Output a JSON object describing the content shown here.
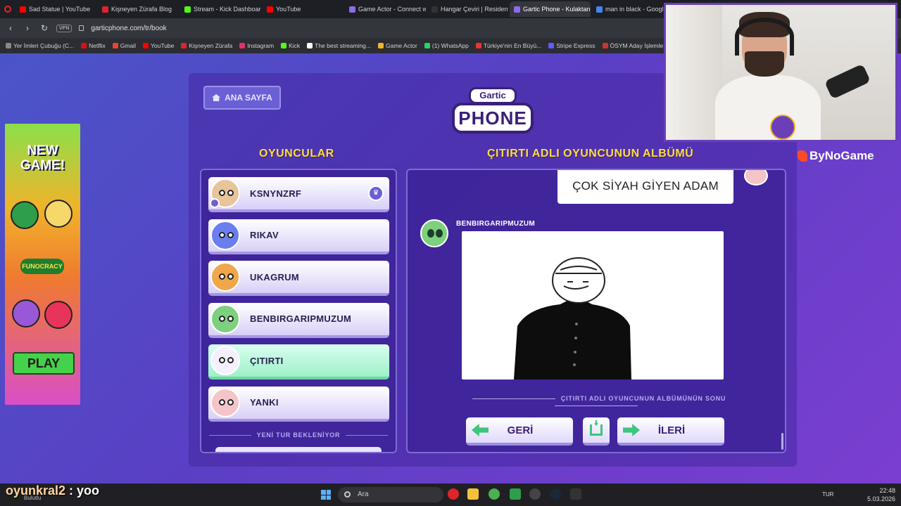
{
  "browser": {
    "tabs": [
      {
        "label": "Sad Statue | YouTube",
        "color": "#ff0000"
      },
      {
        "label": "Kişneyen Zürafa Blog",
        "color": "#e0242b"
      },
      {
        "label": "Stream - Kick Dashboard",
        "color": "#53fc18"
      },
      {
        "label": "YouTube",
        "color": "#ff0000"
      },
      {
        "label": "Game Actor - Connect wit",
        "color": "#8d6be8"
      },
      {
        "label": "Hangar Çeviri | Resident E",
        "color": "#333333"
      },
      {
        "label": "Gartic Phone - Kulaktan K",
        "color": "#8d6be8"
      },
      {
        "label": "man in black - Google'da",
        "color": "#4285f4"
      }
    ],
    "active_tab": 6,
    "vpn": "VPN",
    "url": "garticphone.com/tr/book",
    "bookmarks": [
      "Yer İmleri Çubuğu (C...",
      "Netflix",
      "Gmail",
      "YouTube",
      "Kişneyen Zürafa",
      "Instagram",
      "Kick",
      "The best streaming...",
      "Game Actor",
      "(1) WhatsApp",
      "Türkiye'nin En Büyü...",
      "Stripe Express",
      "ÖSYM Aday İşlemle..."
    ]
  },
  "ad": {
    "title": "NEW GAME!",
    "brand": "FUNOCRACY",
    "play": "PLAY"
  },
  "game": {
    "home_button": "ANA SAYFA",
    "logo_top": "Gartic",
    "logo_bottom": "PHONE",
    "players_title": "OYUNCULAR",
    "album_title": "ÇITIRTI ADLI OYUNCUNUN ALBÜMÜ",
    "sponsor": "ByNoGame",
    "players": [
      {
        "name": "KSNYNZRF",
        "color": "#e8c49a",
        "owner": true
      },
      {
        "name": "RIKAV",
        "color": "#6b7ef0",
        "owner": false
      },
      {
        "name": "UKAGRUM",
        "color": "#f0a64a",
        "owner": false
      },
      {
        "name": "BENBIRGARIPMUZUM",
        "color": "#7ecf7e",
        "owner": false
      },
      {
        "name": "ÇITIRTI",
        "color": "#f4f0ff",
        "owner": false,
        "active": true
      },
      {
        "name": "YANKI",
        "color": "#f4c5c8",
        "owner": false
      }
    ],
    "waiting_text": "YENİ TUR BEKLENİYOR",
    "speech_text": "ÇOK SİYAH GİYEN ADAM",
    "drawer_name": "BENBIRGARIPMUZUM",
    "end_text": "ÇITIRTI ADLI OYUNCUNUN ALBÜMÜNÜN SONU",
    "back_button": "GERİ",
    "next_button": "İLERİ"
  },
  "chat": {
    "user": "oyunkral2",
    "message": " : yoo"
  },
  "taskbar": {
    "weather": "Bulutlu",
    "search_placeholder": "Ara",
    "language": "TUR",
    "time": "22:48",
    "date": "5.03.2026"
  }
}
